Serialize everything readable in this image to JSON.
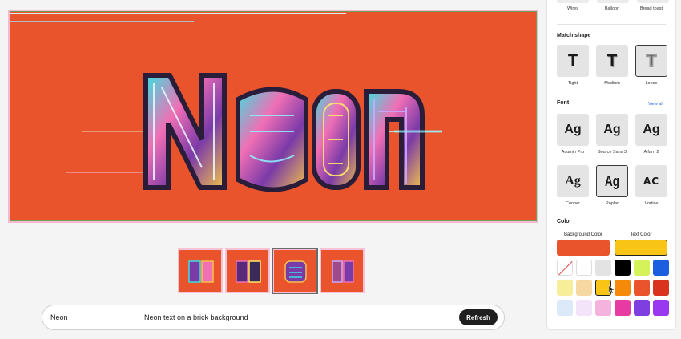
{
  "canvas": {
    "background_color": "#e9542d",
    "preview_text": "Neon"
  },
  "thumbnails": {
    "count": 4,
    "selected_index": 2
  },
  "prompt": {
    "name_value": "Neon",
    "description_value": "Neon text on a brick background",
    "refresh_label": "Refresh"
  },
  "panel": {
    "prev_styles": [
      "Wires",
      "Balloon",
      "Bread toast"
    ],
    "match_shape": {
      "title": "Match shape",
      "options": [
        "Tight",
        "Medium",
        "Loose"
      ],
      "selected": "Loose",
      "glyph": "T"
    },
    "font": {
      "title": "Font",
      "view_all_label": "View all",
      "sample": "Ag",
      "options": [
        "Acumin Pro",
        "Source Sans 3",
        "Alfarn 2",
        "Cooper",
        "Poplar",
        "Vortice"
      ],
      "vortice_sample": "AC",
      "selected": "Poplar"
    },
    "color": {
      "title": "Color",
      "background_label": "Background Color",
      "text_label": "Text Color",
      "background_value": "#e9542d",
      "text_value": "#f8c516",
      "swatches": [
        "none",
        "#ffffff",
        "#e3e3e3",
        "#000000",
        "#d6f25a",
        "#1c5ee0",
        "#f7ee9a",
        "#f7d8a2",
        "#f8c516",
        "#f58a0a",
        "#e9542d",
        "#d9321f",
        "#dbe9f8",
        "#f3e4f9",
        "#f4b3dc",
        "#e83aa3",
        "#7f3fe0",
        "#9a37f0"
      ],
      "selected_swatch": "#f8c516"
    }
  }
}
